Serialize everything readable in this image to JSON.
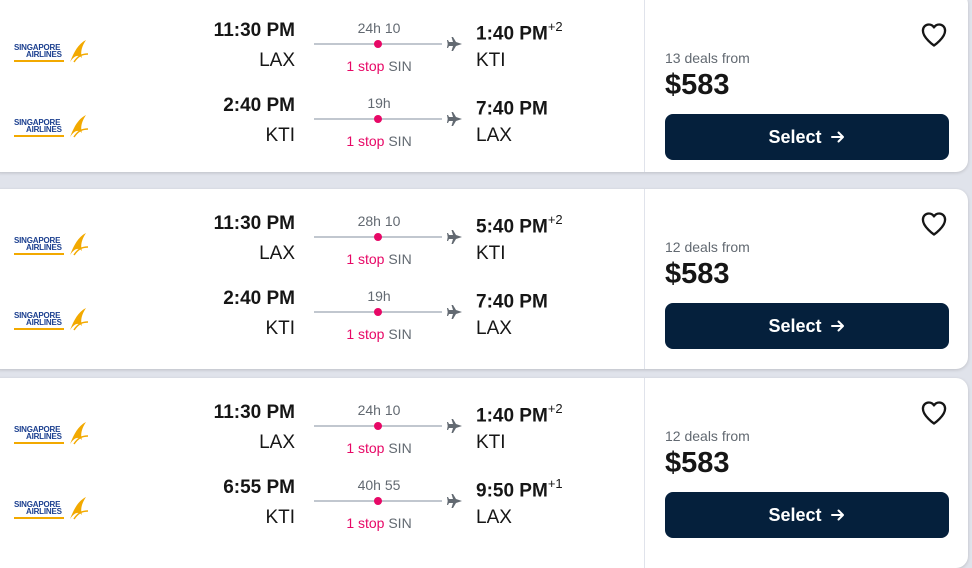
{
  "itineraries": [
    {
      "deals": "13 deals from",
      "price": "$583",
      "select_label": "Select",
      "legs": [
        {
          "airline": "Singapore Airlines",
          "logo_line1": "SINGAPORE",
          "logo_line2": "AIRLINES",
          "dep_time": "11:30 PM",
          "dep_code": "LAX",
          "duration": "24h 10",
          "stops": "1 stop",
          "stop_city": "SIN",
          "arr_time": "1:40 PM",
          "arr_offset": "+2",
          "arr_code": "KTI"
        },
        {
          "airline": "Singapore Airlines",
          "logo_line1": "SINGAPORE",
          "logo_line2": "AIRLINES",
          "dep_time": "2:40 PM",
          "dep_code": "KTI",
          "duration": "19h",
          "stops": "1 stop",
          "stop_city": "SIN",
          "arr_time": "7:40 PM",
          "arr_offset": "",
          "arr_code": "LAX"
        }
      ]
    },
    {
      "deals": "12 deals from",
      "price": "$583",
      "select_label": "Select",
      "legs": [
        {
          "airline": "Singapore Airlines",
          "logo_line1": "SINGAPORE",
          "logo_line2": "AIRLINES",
          "dep_time": "11:30 PM",
          "dep_code": "LAX",
          "duration": "28h 10",
          "stops": "1 stop",
          "stop_city": "SIN",
          "arr_time": "5:40 PM",
          "arr_offset": "+2",
          "arr_code": "KTI"
        },
        {
          "airline": "Singapore Airlines",
          "logo_line1": "SINGAPORE",
          "logo_line2": "AIRLINES",
          "dep_time": "2:40 PM",
          "dep_code": "KTI",
          "duration": "19h",
          "stops": "1 stop",
          "stop_city": "SIN",
          "arr_time": "7:40 PM",
          "arr_offset": "",
          "arr_code": "LAX"
        }
      ]
    },
    {
      "deals": "12 deals from",
      "price": "$583",
      "select_label": "Select",
      "legs": [
        {
          "airline": "Singapore Airlines",
          "logo_line1": "SINGAPORE",
          "logo_line2": "AIRLINES",
          "dep_time": "11:30 PM",
          "dep_code": "LAX",
          "duration": "24h 10",
          "stops": "1 stop",
          "stop_city": "SIN",
          "arr_time": "1:40 PM",
          "arr_offset": "+2",
          "arr_code": "KTI"
        },
        {
          "airline": "Singapore Airlines",
          "logo_line1": "SINGAPORE",
          "logo_line2": "AIRLINES",
          "dep_time": "6:55 PM",
          "dep_code": "KTI",
          "duration": "40h 55",
          "stops": "1 stop",
          "stop_city": "SIN",
          "arr_time": "9:50 PM",
          "arr_offset": "+1",
          "arr_code": "LAX"
        }
      ]
    }
  ],
  "colors": {
    "accent_stop": "#e70866",
    "button_bg": "#05203c",
    "text_primary": "#161616",
    "text_secondary": "#626971",
    "page_bg": "#e0e3eb"
  },
  "icons": {
    "favorite": "heart-outline-icon",
    "arrow": "arrow-right-icon",
    "plane": "plane-icon"
  }
}
